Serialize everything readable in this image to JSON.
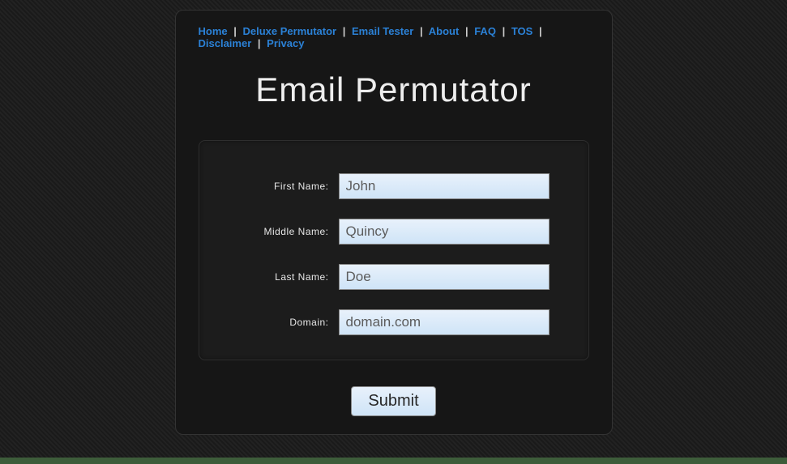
{
  "nav": {
    "home": "Home",
    "deluxe": "Deluxe Permutator",
    "tester": "Email Tester",
    "about": "About",
    "faq": "FAQ",
    "tos": "TOS",
    "disclaimer": "Disclaimer",
    "privacy": "Privacy",
    "sep": "|"
  },
  "title": "Email Permutator",
  "form": {
    "first_label": "First Name:",
    "first_value": "John",
    "middle_label": "Middle Name:",
    "middle_value": "Quincy",
    "last_label": "Last Name:",
    "last_value": "Doe",
    "domain_label": "Domain:",
    "domain_value": "domain.com"
  },
  "submit": "Submit"
}
